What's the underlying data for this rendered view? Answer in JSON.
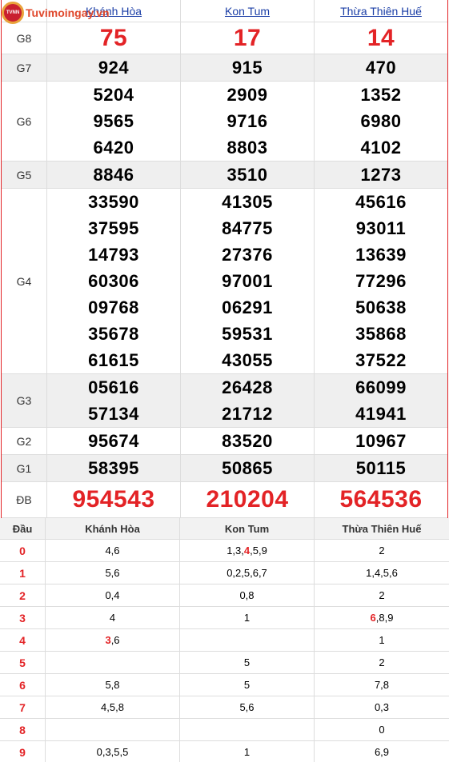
{
  "logo": {
    "text": "Tuvimoingay.vn",
    "badge": "TVNN"
  },
  "provinces": [
    "Khánh Hòa",
    "Kon Tum",
    "Thừa Thiên Huế"
  ],
  "prizes": [
    {
      "label": "G8",
      "values": [
        [
          "75"
        ],
        [
          "17"
        ],
        [
          "14"
        ]
      ]
    },
    {
      "label": "G7",
      "values": [
        [
          "924"
        ],
        [
          "915"
        ],
        [
          "470"
        ]
      ]
    },
    {
      "label": "G6",
      "values": [
        [
          "5204",
          "9565",
          "6420"
        ],
        [
          "2909",
          "9716",
          "8803"
        ],
        [
          "1352",
          "6980",
          "4102"
        ]
      ]
    },
    {
      "label": "G5",
      "values": [
        [
          "8846"
        ],
        [
          "3510"
        ],
        [
          "1273"
        ]
      ]
    },
    {
      "label": "G4",
      "values": [
        [
          "33590",
          "37595",
          "14793",
          "60306",
          "09768",
          "35678",
          "61615"
        ],
        [
          "41305",
          "84775",
          "27376",
          "97001",
          "06291",
          "59531",
          "43055"
        ],
        [
          "45616",
          "93011",
          "13639",
          "77296",
          "50638",
          "35868",
          "37522"
        ]
      ]
    },
    {
      "label": "G3",
      "values": [
        [
          "05616",
          "57134"
        ],
        [
          "26428",
          "21712"
        ],
        [
          "66099",
          "41941"
        ]
      ]
    },
    {
      "label": "G2",
      "values": [
        [
          "95674"
        ],
        [
          "83520"
        ],
        [
          "10967"
        ]
      ]
    },
    {
      "label": "G1",
      "values": [
        [
          "58395"
        ],
        [
          "50865"
        ],
        [
          "50115"
        ]
      ]
    },
    {
      "label": "ĐB",
      "values": [
        [
          "954543"
        ],
        [
          "210204"
        ],
        [
          "564536"
        ]
      ]
    }
  ],
  "stats": {
    "header": {
      "dau": "Đầu",
      "cols": [
        "Khánh Hòa",
        "Kon Tum",
        "Thừa Thiên Huế"
      ]
    },
    "rows": [
      {
        "dau": "0",
        "cols": [
          [
            {
              "t": "4,6"
            }
          ],
          [
            {
              "t": "1,3,"
            },
            {
              "t": "4",
              "hl": true
            },
            {
              "t": ",5,9"
            }
          ],
          [
            {
              "t": "2"
            }
          ]
        ]
      },
      {
        "dau": "1",
        "cols": [
          [
            {
              "t": "5,6"
            }
          ],
          [
            {
              "t": "0,2,5,6,7"
            }
          ],
          [
            {
              "t": "1,4,5,6"
            }
          ]
        ]
      },
      {
        "dau": "2",
        "cols": [
          [
            {
              "t": "0,4"
            }
          ],
          [
            {
              "t": "0,8"
            }
          ],
          [
            {
              "t": "2"
            }
          ]
        ]
      },
      {
        "dau": "3",
        "cols": [
          [
            {
              "t": "4"
            }
          ],
          [
            {
              "t": "1"
            }
          ],
          [
            {
              "t": "6",
              "hl": true
            },
            {
              "t": ",8,9"
            }
          ]
        ]
      },
      {
        "dau": "4",
        "cols": [
          [
            {
              "t": "3",
              "hl": true
            },
            {
              "t": ",6"
            }
          ],
          [],
          [
            {
              "t": "1"
            }
          ]
        ]
      },
      {
        "dau": "5",
        "cols": [
          [],
          [
            {
              "t": "5"
            }
          ],
          [
            {
              "t": "2"
            }
          ]
        ]
      },
      {
        "dau": "6",
        "cols": [
          [
            {
              "t": "5,8"
            }
          ],
          [
            {
              "t": "5"
            }
          ],
          [
            {
              "t": "7,8"
            }
          ]
        ]
      },
      {
        "dau": "7",
        "cols": [
          [
            {
              "t": "4,5,8"
            }
          ],
          [
            {
              "t": "5,6"
            }
          ],
          [
            {
              "t": "0,3"
            }
          ]
        ]
      },
      {
        "dau": "8",
        "cols": [
          [],
          [],
          [
            {
              "t": "0"
            }
          ]
        ]
      },
      {
        "dau": "9",
        "cols": [
          [
            {
              "t": "0,3,5,5"
            }
          ],
          [
            {
              "t": "1"
            }
          ],
          [
            {
              "t": "6,9"
            }
          ]
        ]
      }
    ]
  }
}
